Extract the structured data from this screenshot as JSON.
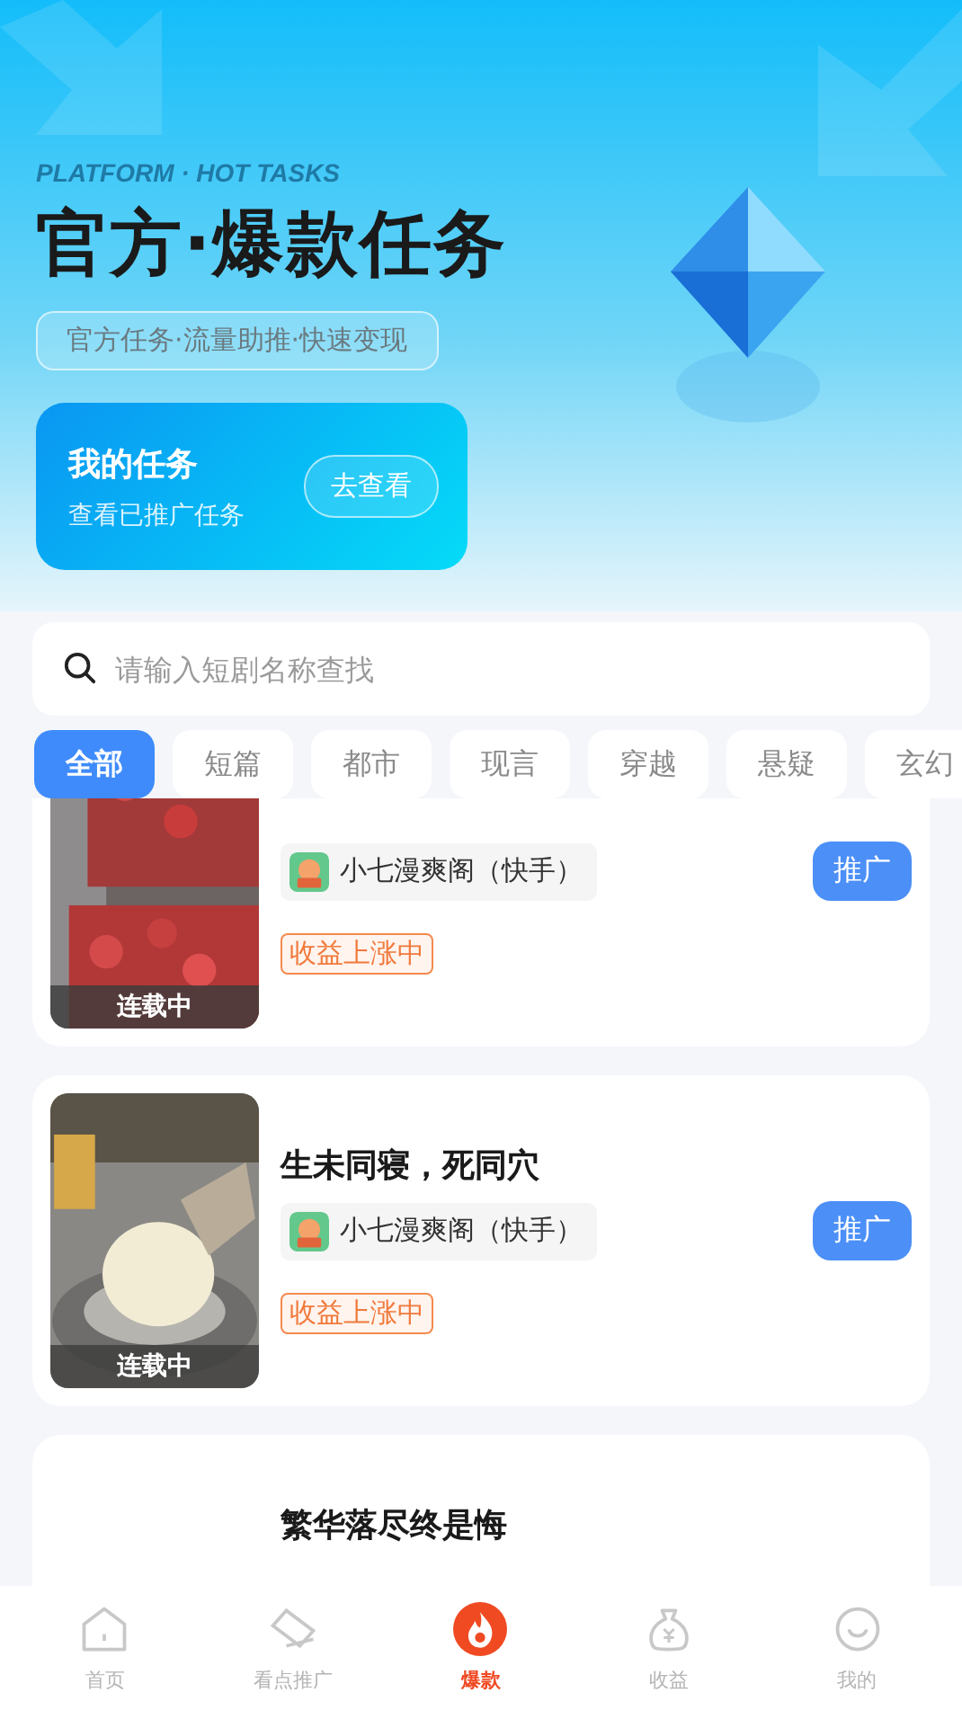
{
  "header": {
    "eyebrow": "PLATFORM · HOT TASKS",
    "title": "官方·爆款任务",
    "subtitle": "官方任务·流量助推·快速变现"
  },
  "my_tasks": {
    "title": "我的任务",
    "subtitle": "查看已推广任务",
    "button": "去查看"
  },
  "search": {
    "placeholder": "请输入短剧名称查找"
  },
  "categories": [
    {
      "label": "全部",
      "selected": true
    },
    {
      "label": "短篇",
      "selected": false
    },
    {
      "label": "都市",
      "selected": false
    },
    {
      "label": "现言",
      "selected": false
    },
    {
      "label": "穿越",
      "selected": false
    },
    {
      "label": "悬疑",
      "selected": false
    },
    {
      "label": "玄幻",
      "selected": false
    }
  ],
  "dramas": [
    {
      "kind": "picture",
      "status": "连载中",
      "source": "小七漫爽阁（快手）",
      "badge": "收益上涨中",
      "button": "推广"
    },
    {
      "kind": "picture",
      "status": "连载中",
      "title": "生未同寝，死同穴",
      "source": "小七漫爽阁（快手）",
      "badge": "收益上涨中",
      "button": "推广"
    },
    {
      "title": "繁华落尽终是悔"
    }
  ],
  "tab_bar": [
    {
      "label": "首页",
      "selected": false
    },
    {
      "label": "看点推广",
      "selected": false
    },
    {
      "label": "爆款",
      "selected": true
    },
    {
      "label": "收益",
      "selected": false
    },
    {
      "label": "我的",
      "selected": false
    }
  ]
}
